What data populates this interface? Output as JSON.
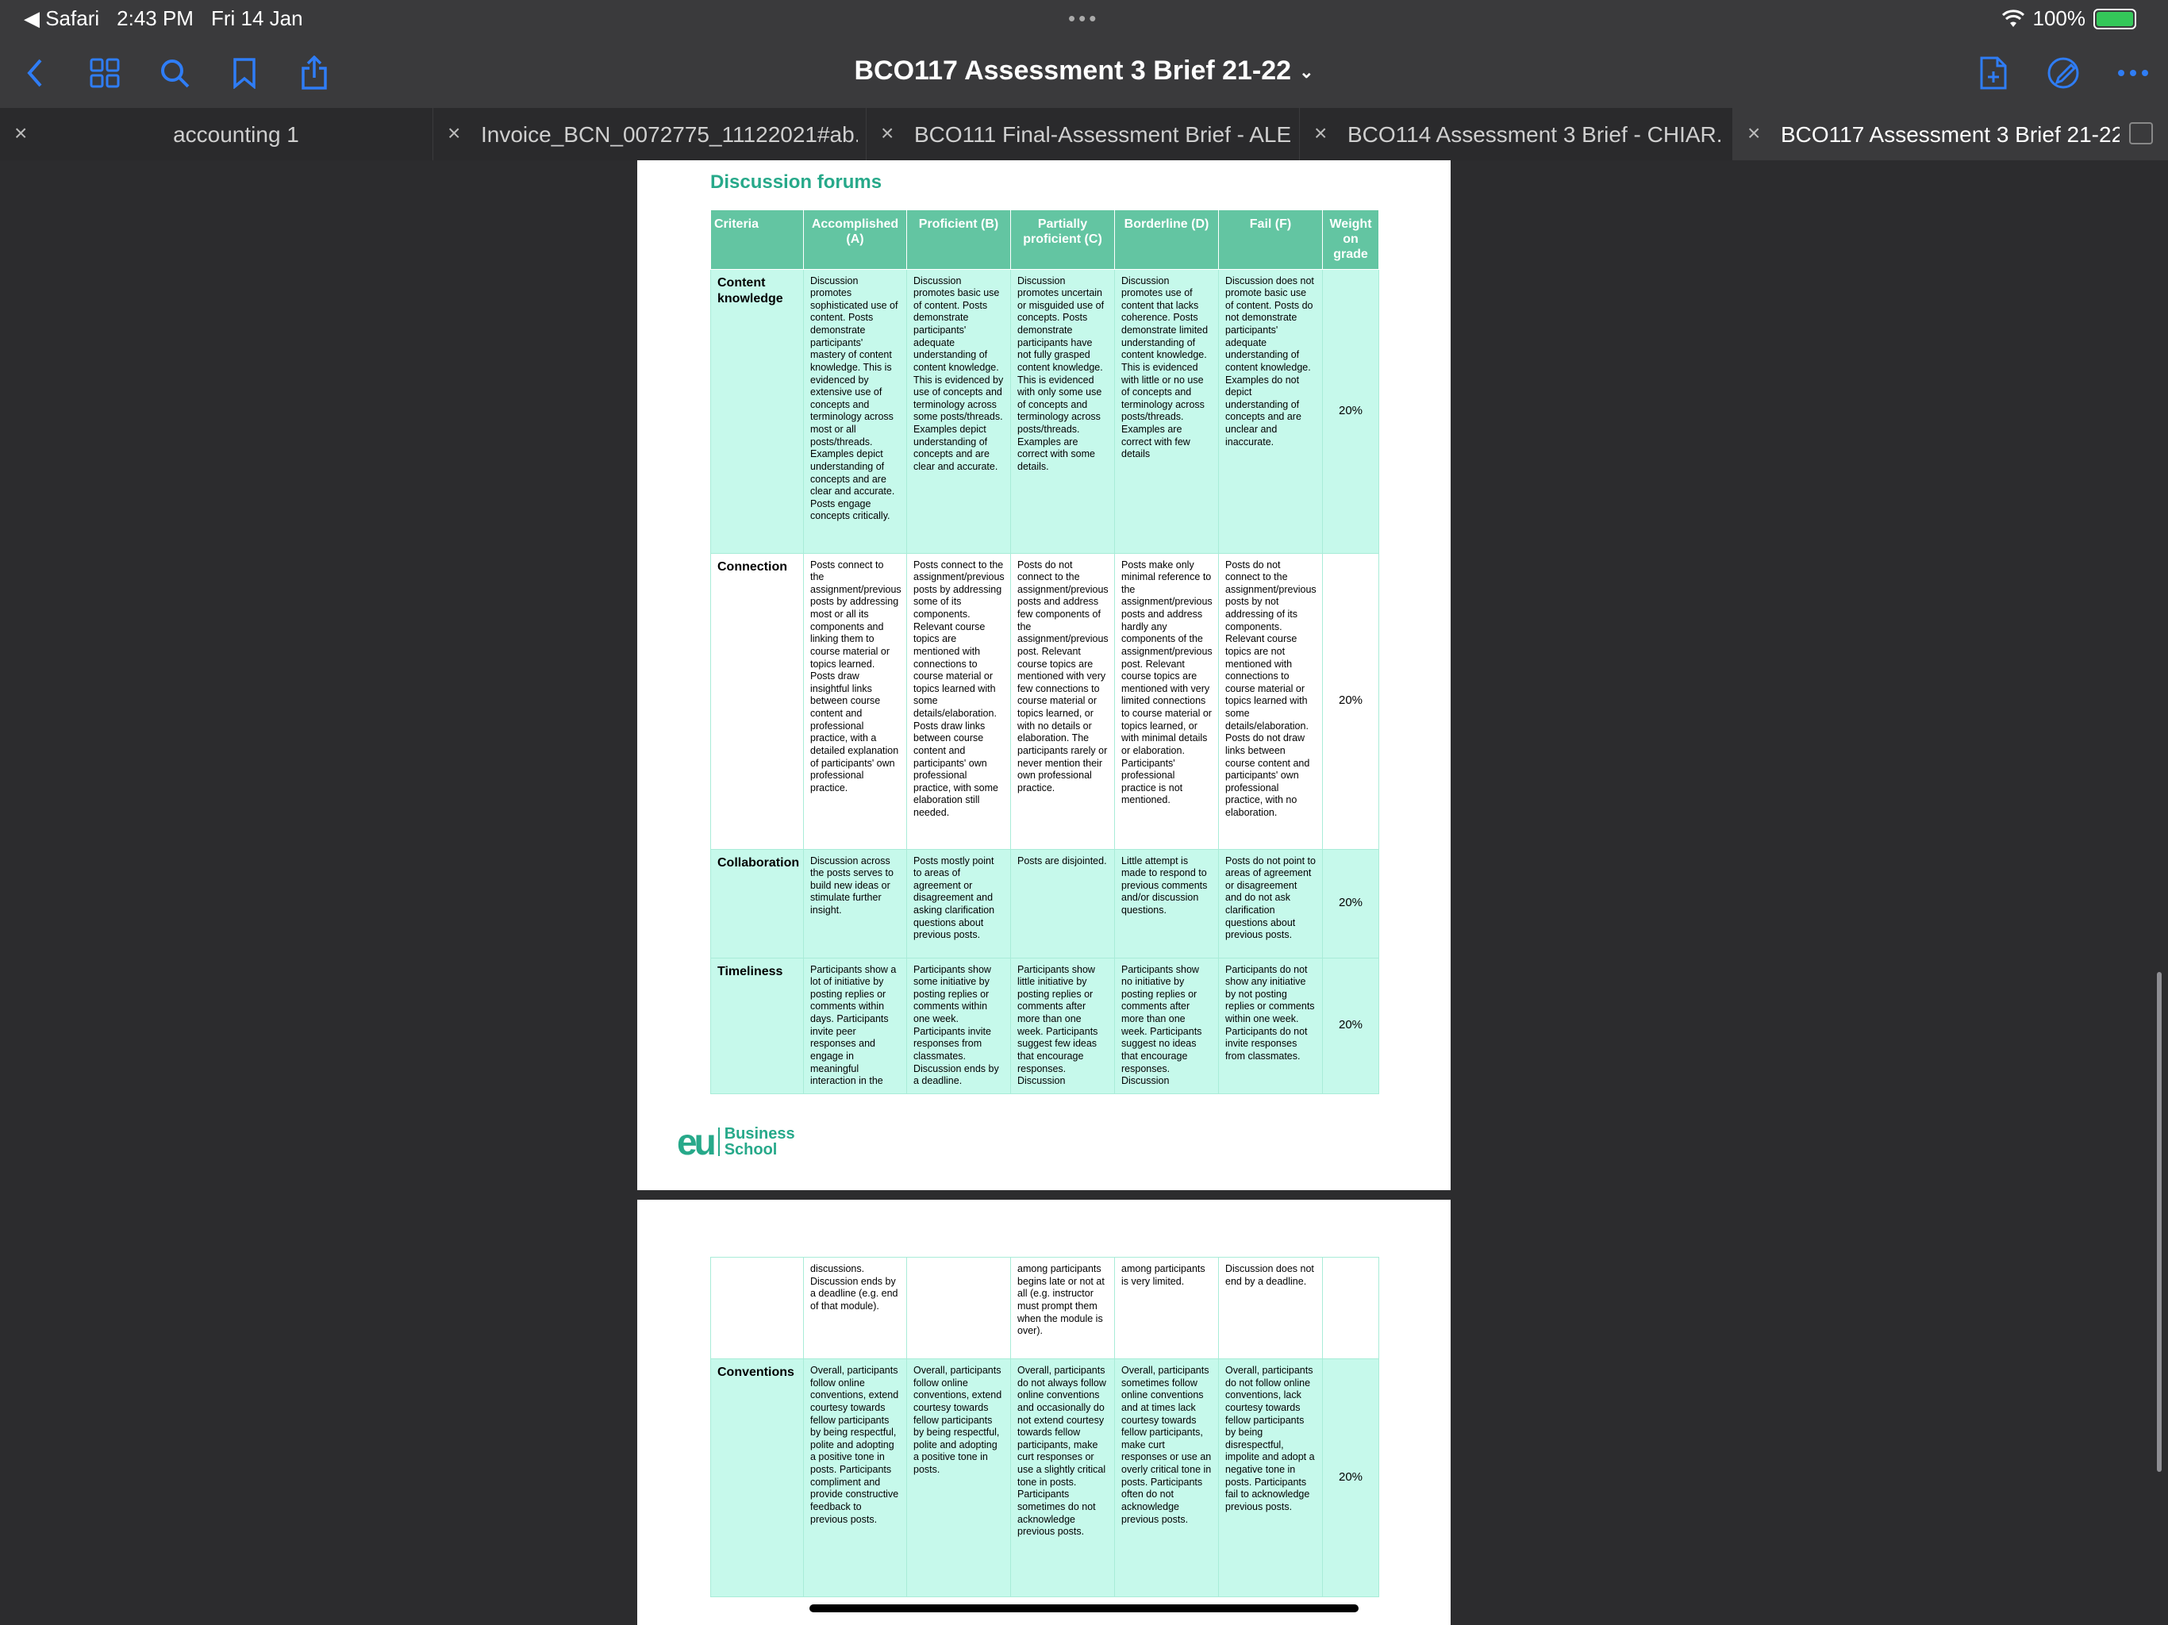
{
  "status": {
    "back_app": "Safari",
    "time": "2:43 PM",
    "date": "Fri 14 Jan",
    "battery": "100%",
    "battery_level": 1.0
  },
  "toolbar": {
    "title": "BCO117 Assessment 3 Brief 21-22",
    "icons": [
      "back-chevron-icon",
      "grid-icon",
      "search-icon",
      "bookmark-icon",
      "share-icon",
      "add-page-icon",
      "markup-icon",
      "more-icon"
    ]
  },
  "tabs": [
    {
      "label": "accounting 1"
    },
    {
      "label": "Invoice_BCN_0072775_11122021#ab..."
    },
    {
      "label": "BCO111 Final-Assessment Brief - ALE..."
    },
    {
      "label": "BCO114 Assessment 3 Brief - CHIAR..."
    },
    {
      "label": "BCO117 Assessment 3 Brief 21-22"
    }
  ],
  "doc": {
    "section_title": "Discussion forums",
    "headers": [
      "Criteria",
      "Accomplished (A)",
      "Proficient (B)",
      "Partially proficient (C)",
      "Borderline (D)",
      "Fail (F)",
      "Weight on grade"
    ],
    "rows": [
      {
        "criteria": "Content knowledge",
        "a": "Discussion promotes sophisticated use of content. Posts demonstrate participants' mastery of content knowledge. This is evidenced by extensive use of concepts and terminology across most or all posts/threads. Examples depict understanding of concepts and are clear and accurate. Posts engage concepts critically.",
        "b": "Discussion promotes basic use of content. Posts demonstrate participants' adequate understanding of content knowledge. This is evidenced by use of concepts and terminology across some posts/threads. Examples depict understanding of concepts and are clear and accurate.",
        "c": "Discussion promotes uncertain or misguided use of concepts. Posts demonstrate participants have not fully grasped content knowledge. This is evidenced with only some use of concepts and terminology across posts/threads. Examples are correct with some details.",
        "d": "Discussion promotes use of content that lacks coherence. Posts demonstrate limited understanding of content knowledge. This is evidenced with little or no use of concepts and terminology across posts/threads. Examples are correct with few details",
        "f": "Discussion does not promote basic use of content. Posts do not demonstrate participants' adequate understanding of content knowledge. Examples do not depict understanding of concepts and are unclear and inaccurate.",
        "weight": "20%"
      },
      {
        "criteria": "Connection",
        "a": "Posts connect to the assignment/previous posts by addressing most or all its components and linking them to course material or topics learned. Posts draw insightful links between course content and professional practice, with a detailed explanation of participants' own professional practice.",
        "b": "Posts connect to the assignment/previous posts by addressing some of its components. Relevant course topics are mentioned with connections to course material or topics learned with some details/elaboration. Posts draw links between course content and participants' own professional practice, with some elaboration still needed.",
        "c": "Posts do not connect to the assignment/previous posts and address few components of the assignment/previous post. Relevant course topics are mentioned with very few connections to course material or topics learned, or with no details or elaboration. The participants rarely or never mention their own professional practice.",
        "d": "Posts make only minimal reference to the assignment/previous posts and address hardly any components of the assignment/previous post. Relevant course topics are mentioned with very limited connections to course material or topics learned, or with minimal details or elaboration. Participants' professional practice is not mentioned.",
        "f": "Posts do not connect to the assignment/previous posts by not addressing of its components. Relevant course topics are not mentioned with connections to course material or topics learned with some details/elaboration. Posts do not draw links between course content and participants' own professional practice, with no elaboration.",
        "weight": "20%"
      },
      {
        "criteria": "Collaboration",
        "a": "Discussion across the posts serves to build new ideas or stimulate further insight.",
        "b": "Posts mostly point to areas of agreement or disagreement and asking clarification questions about previous posts.",
        "c": "Posts are disjointed.",
        "d": "Little attempt is made to respond to previous comments and/or discussion questions.",
        "f": "Posts do not point to areas of agreement or disagreement and do not ask clarification questions about previous posts.",
        "weight": "20%"
      },
      {
        "criteria": "Timeliness",
        "a": "Participants show a lot of initiative by posting replies or comments within days. Participants invite peer responses and engage in meaningful interaction in the",
        "b": "Participants show some initiative by posting replies or comments within one week. Participants invite responses from classmates. Discussion ends by a deadline.",
        "c": "Participants show little initiative by posting replies or comments after more than one week. Participants suggest few ideas that encourage responses. Discussion",
        "d": "Participants show no initiative by posting replies or comments after more than one week. Participants suggest no ideas that encourage responses. Discussion",
        "f": "Participants do not show any initiative by not posting replies or comments within one week. Participants do not invite responses from classmates.",
        "weight": "20%"
      }
    ],
    "rows2": [
      {
        "criteria": "",
        "a": "discussions. Discussion ends by a deadline (e.g. end of that module).",
        "b": "",
        "c": "among participants begins late or not at all (e.g. instructor must prompt them when the module is over).",
        "d": "among participants is very limited.",
        "f": "Discussion does not end by a deadline.",
        "weight": ""
      },
      {
        "criteria": "Conventions",
        "a": "Overall, participants follow online conventions, extend courtesy towards fellow participants by being respectful, polite and adopting a positive tone in posts. Participants compliment and provide constructive feedback to previous posts.",
        "b": "Overall, participants follow online conventions, extend courtesy towards fellow participants by being respectful, polite and adopting a positive tone in posts.",
        "c": "Overall, participants do not always follow online conventions and occasionally do not extend courtesy towards fellow participants, make curt responses or use a slightly critical tone in posts. Participants sometimes do not acknowledge previous posts.",
        "d": "Overall, participants sometimes follow online conventions and at times lack courtesy towards fellow participants, make curt responses or use an overly critical tone in posts. Participants often do not acknowledge previous posts.",
        "f": "Overall, participants do not follow online conventions, lack courtesy towards fellow participants by being disrespectful, impolite and adopt a negative tone in posts. Participants fail to acknowledge previous posts.",
        "weight": "20%"
      }
    ],
    "logo": {
      "mark": "eu",
      "line1": "Business",
      "line2": "School"
    }
  }
}
